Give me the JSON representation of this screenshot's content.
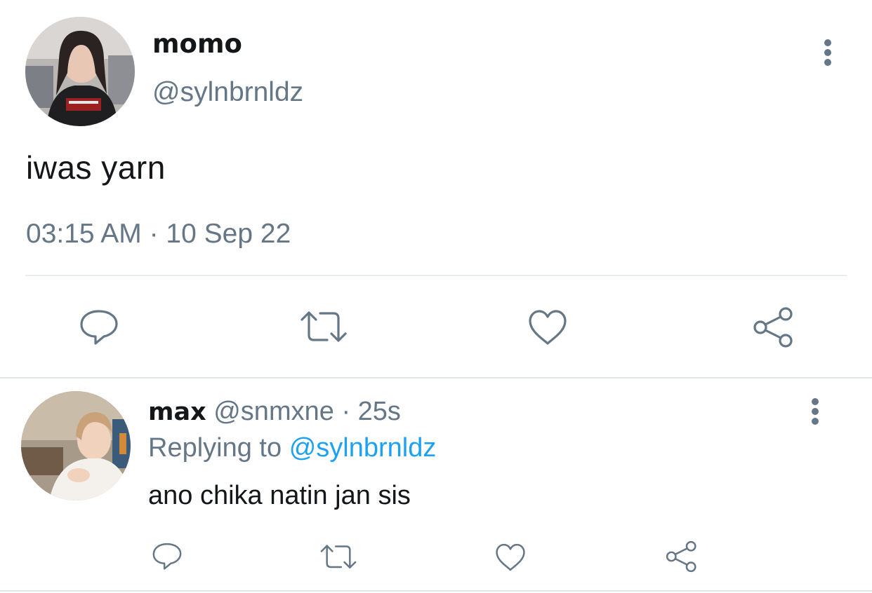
{
  "tweet": {
    "display_name": "momo",
    "handle": "@sylnbrnldz",
    "text": "iwas yarn",
    "timestamp": "03:15 AM · 10 Sep 22",
    "avatar": "avatar-photo",
    "actions": [
      {
        "name": "reply",
        "icon": "reply-icon"
      },
      {
        "name": "retweet",
        "icon": "retweet-icon"
      },
      {
        "name": "like",
        "icon": "heart-icon"
      },
      {
        "name": "share",
        "icon": "share-icon"
      }
    ],
    "more_icon": "more-vertical-icon"
  },
  "reply": {
    "display_name": "max",
    "handle": "@snmxne",
    "separator": "·",
    "time": "25s",
    "replying_to_label": "Replying to",
    "replying_to_handle": "@sylnbrnldz",
    "text": "ano chika natin jan sis",
    "avatar": "avatar-photo",
    "more_icon": "more-vertical-icon"
  },
  "colors": {
    "text": "#14171a",
    "secondary": "#657786",
    "link": "#1da1f2",
    "divider": "#e6ecf0",
    "background": "#ffffff"
  }
}
